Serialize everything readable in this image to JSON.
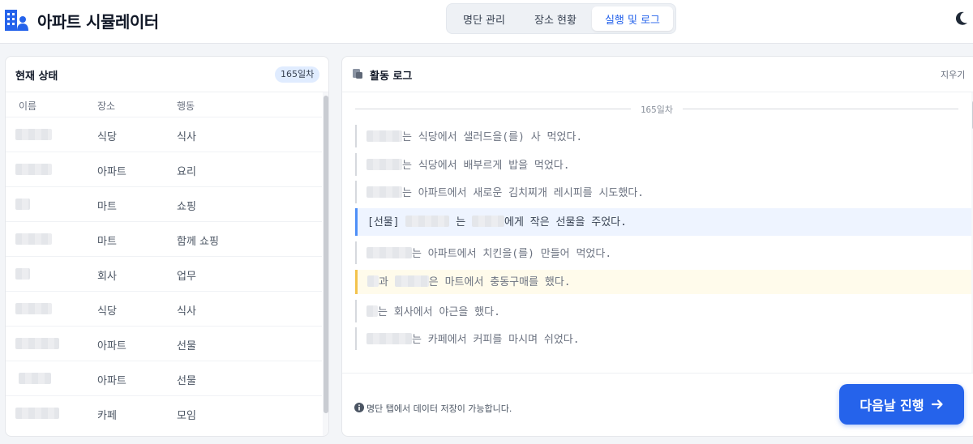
{
  "app": {
    "title": "아파트 시뮬레이터"
  },
  "tabs": [
    {
      "label": "명단 관리",
      "active": false
    },
    {
      "label": "장소 현황",
      "active": false
    },
    {
      "label": "실행 및 로그",
      "active": true
    }
  ],
  "status_panel": {
    "title": "현재 상태",
    "day_badge": "165일차",
    "columns": [
      "이름",
      "장소",
      "행동"
    ],
    "rows": [
      {
        "name": "",
        "location": "식당",
        "action": "식사"
      },
      {
        "name": "",
        "location": "아파트",
        "action": "요리"
      },
      {
        "name": "",
        "location": "마트",
        "action": "쇼핑"
      },
      {
        "name": "",
        "location": "마트",
        "action": "함께 쇼핑"
      },
      {
        "name": "",
        "location": "회사",
        "action": "업무"
      },
      {
        "name": "",
        "location": "식당",
        "action": "식사"
      },
      {
        "name": "",
        "location": "아파트",
        "action": "선물"
      },
      {
        "name": "",
        "location": "아파트",
        "action": "선물"
      },
      {
        "name": "",
        "location": "카페",
        "action": "모임"
      }
    ]
  },
  "log_panel": {
    "title": "활동 로그",
    "clear_label": "지우기",
    "day_divider": "165일차",
    "entries": [
      {
        "type": "normal",
        "text": "는 식당에서 샐러드을(를) 사 먹었다."
      },
      {
        "type": "normal",
        "text": "는 식당에서 배부르게 밥을 먹었다."
      },
      {
        "type": "normal",
        "text": "는 아파트에서 새로운 김치찌개 레시피를 시도했다."
      },
      {
        "type": "gift",
        "prefix": "[선물] ",
        "mid": "는 ",
        "text": "에게 작은 선물을 주었다."
      },
      {
        "type": "normal",
        "text": "는 아파트에서 치킨을(를) 만들어 먹었다."
      },
      {
        "type": "group",
        "mid": "과 ",
        "text": "은 마트에서 충동구매를 했다."
      },
      {
        "type": "normal",
        "text": "는 회사에서 야근을 했다."
      },
      {
        "type": "normal",
        "text": "는 카페에서 커피를 마시며 쉬었다."
      }
    ],
    "hint": "명단 탭에서 데이터 저장이 가능합니다.",
    "next_button": "다음날 진행"
  },
  "icons": {
    "logo": "apartment-people-icon",
    "theme": "moon-icon",
    "log": "scroll-icon",
    "info": "info-icon",
    "next": "arrow-right-icon"
  },
  "colors": {
    "accent": "#2563eb",
    "gift_bar": "#4f8ff7",
    "group_bar": "#f3c34d"
  }
}
